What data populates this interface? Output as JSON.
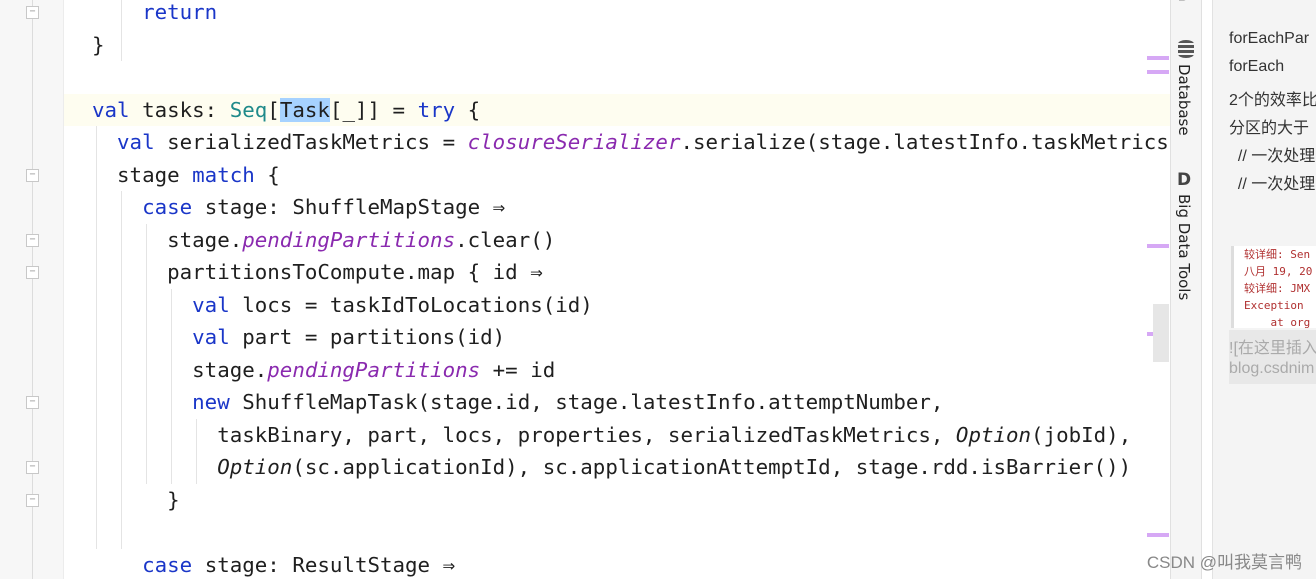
{
  "editor": {
    "current_line": 3,
    "lines": [
      {
        "indent": 4,
        "tokens": [
          [
            "return",
            "kw"
          ]
        ]
      },
      {
        "indent": 0,
        "tokens": [
          [
            "}",
            ""
          ]
        ]
      },
      {
        "indent": 0,
        "tokens": []
      },
      {
        "indent": 0,
        "tokens": [
          [
            "val",
            "kw"
          ],
          [
            " tasks: ",
            ""
          ],
          [
            "Seq",
            "ty"
          ],
          [
            "[",
            ""
          ],
          [
            "Task",
            "sel"
          ],
          [
            "[_]] = ",
            ""
          ],
          [
            "try",
            "kw"
          ],
          [
            " {",
            ""
          ]
        ]
      },
      {
        "indent": 2,
        "tokens": [
          [
            "val",
            "kw"
          ],
          [
            " serializedTaskMetrics = ",
            ""
          ],
          [
            "closureSerializer",
            "it"
          ],
          [
            ".serialize(stage.latestInfo.taskMetrics",
            ""
          ]
        ]
      },
      {
        "indent": 2,
        "tokens": [
          [
            "stage ",
            ""
          ],
          [
            "match",
            "kw"
          ],
          [
            " {",
            ""
          ]
        ]
      },
      {
        "indent": 4,
        "tokens": [
          [
            "case",
            "kw"
          ],
          [
            " stage: ShuffleMapStage ⇒",
            ""
          ]
        ]
      },
      {
        "indent": 6,
        "tokens": [
          [
            "stage.",
            ""
          ],
          [
            "pendingPartitions",
            "it"
          ],
          [
            ".clear()",
            ""
          ]
        ]
      },
      {
        "indent": 6,
        "tokens": [
          [
            "partitionsToCompute.map { id ⇒",
            ""
          ]
        ]
      },
      {
        "indent": 8,
        "tokens": [
          [
            "val",
            "kw"
          ],
          [
            " locs = taskIdToLocations(id)",
            ""
          ]
        ]
      },
      {
        "indent": 8,
        "tokens": [
          [
            "val",
            "kw"
          ],
          [
            " part = partitions(id)",
            ""
          ]
        ]
      },
      {
        "indent": 8,
        "tokens": [
          [
            "stage.",
            ""
          ],
          [
            "pendingPartitions",
            "it"
          ],
          [
            " += id",
            ""
          ]
        ]
      },
      {
        "indent": 8,
        "tokens": [
          [
            "new",
            "kw"
          ],
          [
            " ShuffleMapTask(stage.id, stage.latestInfo.attemptNumber,",
            ""
          ]
        ]
      },
      {
        "indent": 10,
        "tokens": [
          [
            "taskBinary, part, locs, properties, serializedTaskMetrics, ",
            ""
          ],
          [
            "Option",
            "obj"
          ],
          [
            "(jobId),",
            ""
          ]
        ]
      },
      {
        "indent": 10,
        "tokens": [
          [
            "Option",
            "obj"
          ],
          [
            "(sc.applicationId), sc.applicationAttemptId, stage.rdd.isBarrier())",
            ""
          ]
        ]
      },
      {
        "indent": 6,
        "tokens": [
          [
            "}",
            ""
          ]
        ]
      },
      {
        "indent": 0,
        "tokens": []
      },
      {
        "indent": 4,
        "tokens": [
          [
            "case",
            "kw"
          ],
          [
            " stage: ResultStage ⇒",
            ""
          ]
        ]
      }
    ]
  },
  "tool_windows": [
    {
      "label": "Database",
      "icon": "database-icon"
    },
    {
      "label": "Big Data Tools",
      "icon": "big-data-tools-icon"
    }
  ],
  "panel": {
    "lines": [
      "forEachPar",
      "forEach",
      "2个的效率比",
      "分区的大于",
      "  // 一次处理",
      "  // 一次处理"
    ],
    "code_image_lines": [
      "较详细: Sen",
      "八月 19, 20",
      "较详细: JMX",
      "Exception ",
      "    at org"
    ],
    "image_link": "![在这里插入",
    "image_url": "blog.csdnim"
  },
  "watermark": "CSDN @叫我莫言鸭",
  "colors": {
    "keyword": "#1a36c8",
    "type": "#1f8a8a",
    "italic_field": "#8a2aaf",
    "selection": "#a6d2ff",
    "marker": "#d6a8f5"
  }
}
